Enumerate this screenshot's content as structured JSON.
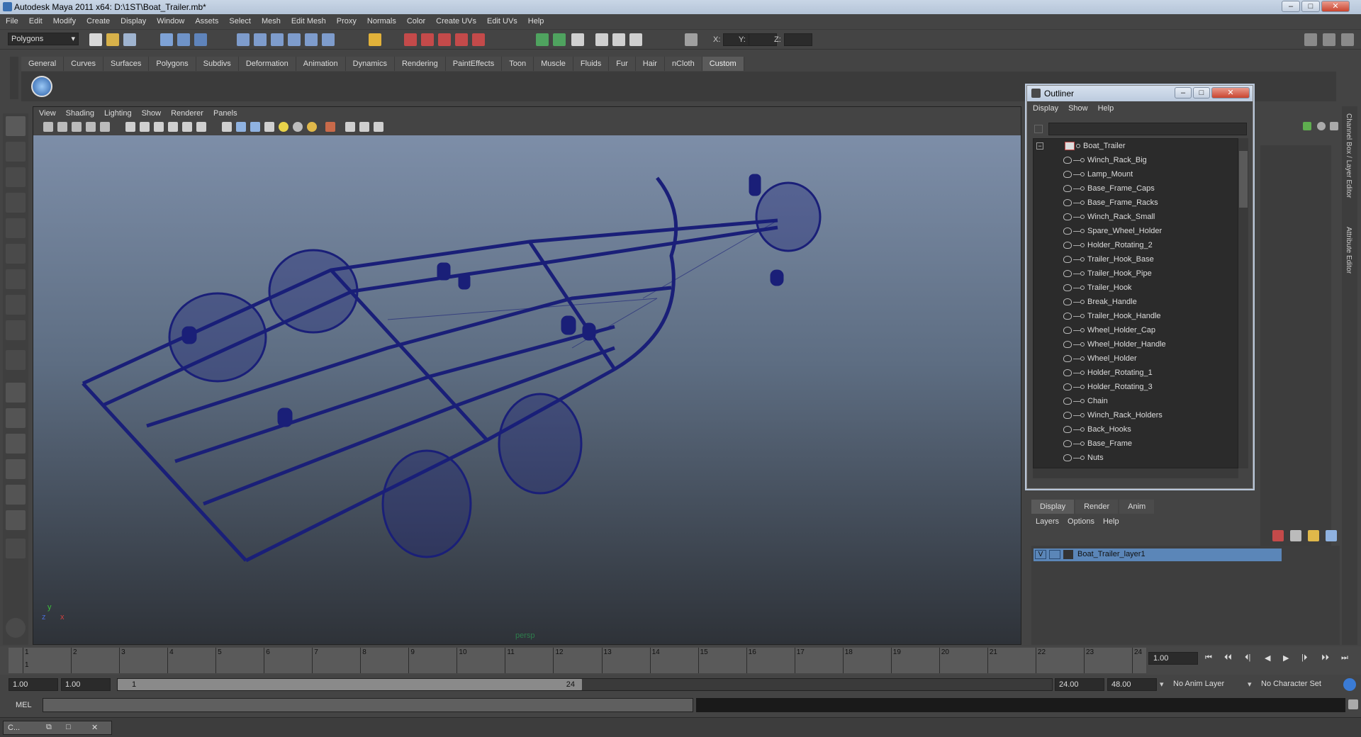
{
  "window": {
    "title": "Autodesk Maya 2011 x64: D:\\1ST\\Boat_Trailer.mb*"
  },
  "menubar": [
    "File",
    "Edit",
    "Modify",
    "Create",
    "Display",
    "Window",
    "Assets",
    "Select",
    "Mesh",
    "Edit Mesh",
    "Proxy",
    "Normals",
    "Color",
    "Create UVs",
    "Edit UVs",
    "Help"
  ],
  "statusline": {
    "mode": "Polygons",
    "x_label": "X:",
    "y_label": "Y:",
    "z_label": "Z:"
  },
  "shelf": {
    "tabs": [
      "General",
      "Curves",
      "Surfaces",
      "Polygons",
      "Subdivs",
      "Deformation",
      "Animation",
      "Dynamics",
      "Rendering",
      "PaintEffects",
      "Toon",
      "Muscle",
      "Fluids",
      "Fur",
      "Hair",
      "nCloth",
      "Custom"
    ],
    "active_tab": "Custom"
  },
  "viewport": {
    "menu": [
      "View",
      "Shading",
      "Lighting",
      "Show",
      "Renderer",
      "Panels"
    ],
    "camera_label": "persp",
    "axis_y": "y",
    "axis_x": "x",
    "axis_z": "z"
  },
  "outliner": {
    "title": "Outliner",
    "menu": [
      "Display",
      "Show",
      "Help"
    ],
    "root": "Boat_Trailer",
    "items": [
      "Winch_Rack_Big",
      "Lamp_Mount",
      "Base_Frame_Caps",
      "Base_Frame_Racks",
      "Winch_Rack_Small",
      "Spare_Wheel_Holder",
      "Holder_Rotating_2",
      "Trailer_Hook_Base",
      "Trailer_Hook_Pipe",
      "Trailer_Hook",
      "Break_Handle",
      "Trailer_Hook_Handle",
      "Wheel_Holder_Cap",
      "Wheel_Holder_Handle",
      "Wheel_Holder",
      "Holder_Rotating_1",
      "Holder_Rotating_3",
      "Chain",
      "Winch_Rack_Holders",
      "Back_Hooks",
      "Base_Frame",
      "Nuts"
    ]
  },
  "side_tabs": [
    "Channel Box / Layer Editor",
    "Attribute Editor"
  ],
  "layer_editor": {
    "tabs": [
      "Display",
      "Render",
      "Anim"
    ],
    "active_tab": "Display",
    "menu": [
      "Layers",
      "Options",
      "Help"
    ],
    "layer": {
      "visible": "V",
      "name": "Boat_Trailer_layer1"
    }
  },
  "timeline": {
    "ticks": [
      "1",
      "2",
      "3",
      "4",
      "5",
      "6",
      "7",
      "8",
      "9",
      "10",
      "11",
      "12",
      "13",
      "14",
      "15",
      "16",
      "17",
      "18",
      "19",
      "20",
      "21",
      "22",
      "23",
      "24"
    ],
    "current_frame": "1.00",
    "playhead_label": "1"
  },
  "range": {
    "start": "1.00",
    "inner_start": "1.00",
    "slider_start": "1",
    "slider_end": "24",
    "end": "24.00",
    "anim_end": "48.00",
    "anim_layer": "No Anim Layer",
    "character_set": "No Character Set"
  },
  "commandline": {
    "label": "MEL"
  },
  "taskbar": {
    "item": "C..."
  },
  "colors": {
    "wireframe": "#1a1f78",
    "selected_layer": "#5b86b8"
  }
}
